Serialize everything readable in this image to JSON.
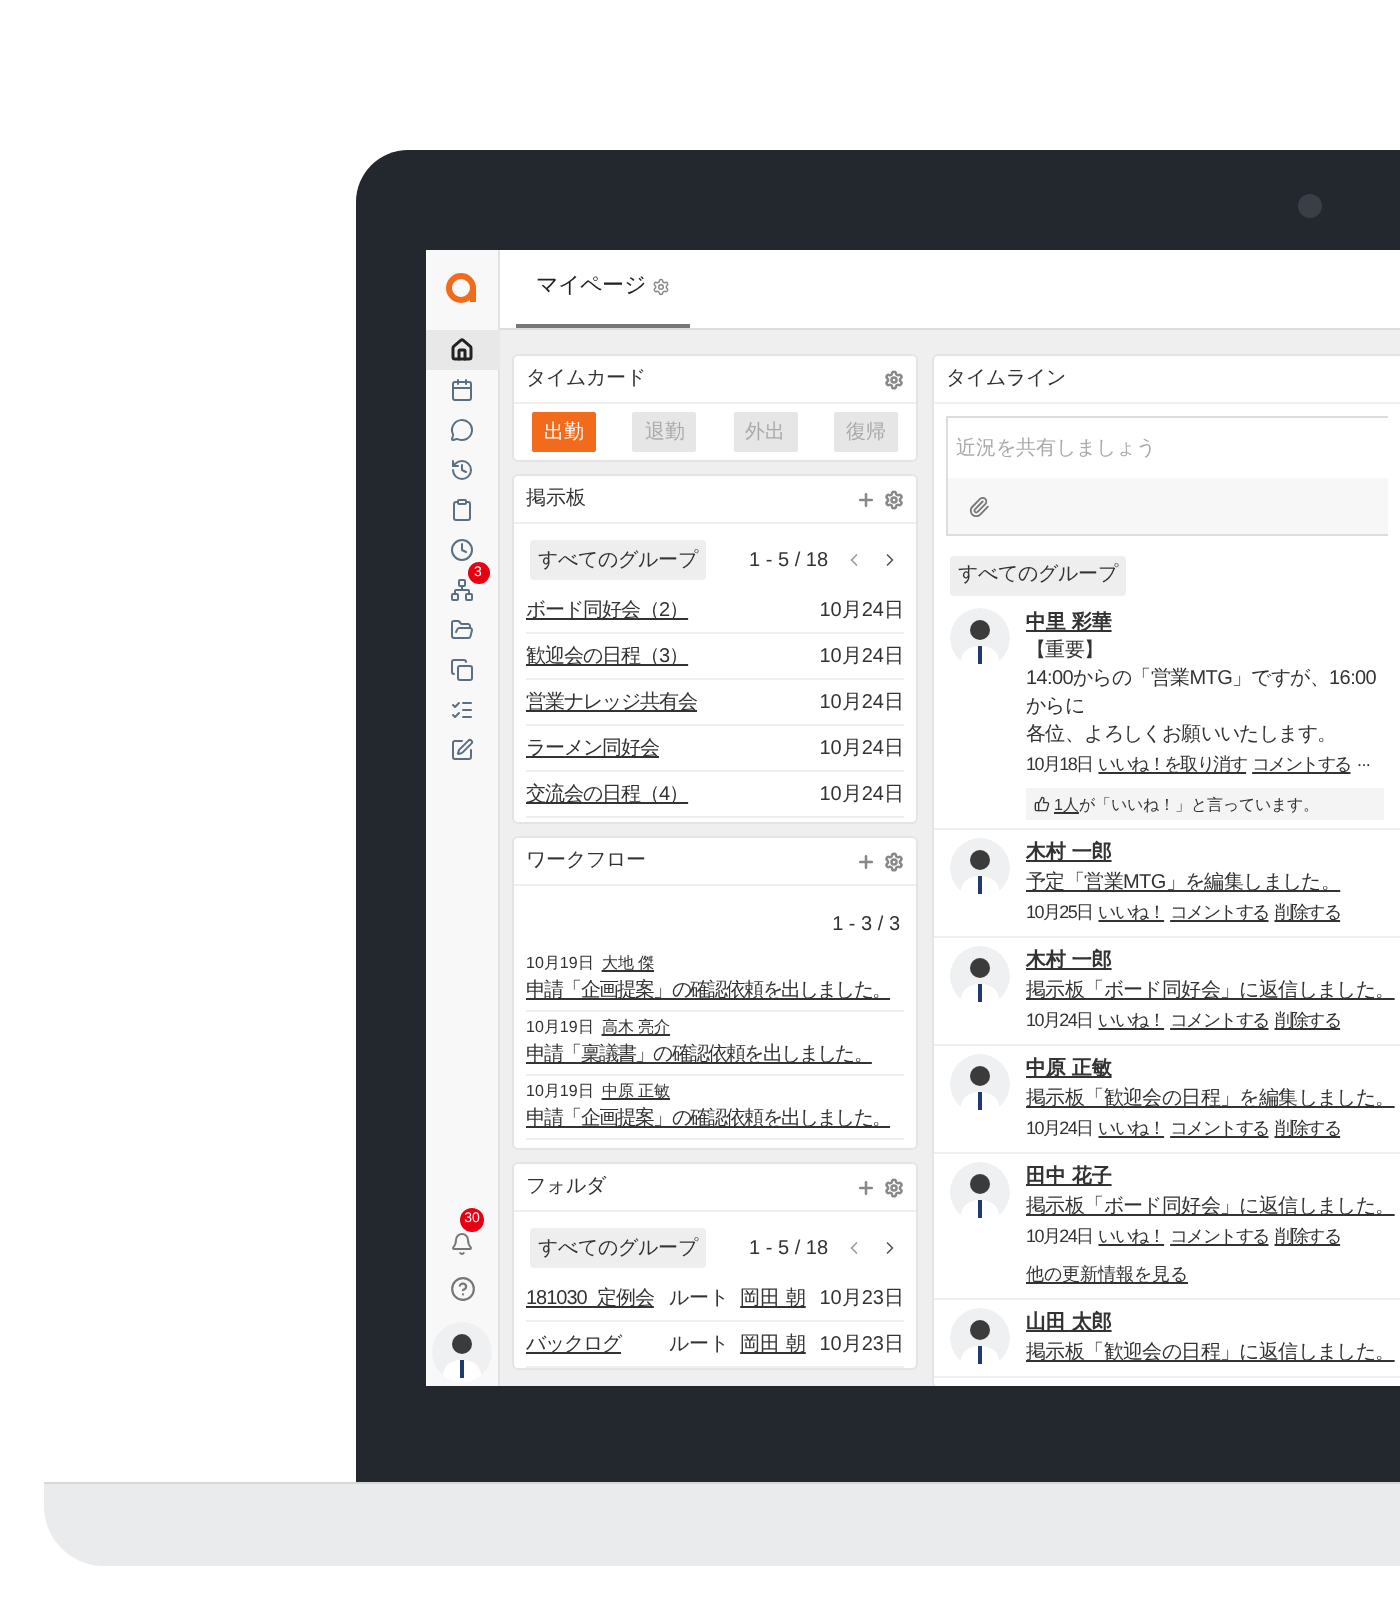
{
  "header": {
    "tab": "マイページ"
  },
  "sidebar": {
    "items": [
      {
        "selected": true
      },
      {
        "selected": false
      },
      {
        "selected": false
      },
      {
        "selected": false
      },
      {
        "selected": false
      },
      {
        "selected": false
      },
      {
        "selected": false,
        "badge": "3"
      },
      {
        "selected": false
      },
      {
        "selected": false
      },
      {
        "selected": false
      },
      {
        "selected": false
      }
    ],
    "bottom": [
      {
        "kind": "bell",
        "badge": "30"
      },
      {
        "kind": "help"
      }
    ]
  },
  "timecard": {
    "title": "タイムカード",
    "buttons": [
      {
        "label": "出勤",
        "selected": true
      },
      {
        "label": "退勤",
        "selected": false
      },
      {
        "label": "外出",
        "selected": false
      },
      {
        "label": "復帰",
        "selected": false
      }
    ]
  },
  "board": {
    "title": "掲示板",
    "group": "すべてのグループ",
    "pager": "1 - 5 / 18",
    "rows": [
      {
        "title": "ボード同好会（2）",
        "date": "10月24日"
      },
      {
        "title": "歓迎会の日程（3）",
        "date": "10月24日"
      },
      {
        "title": "営業ナレッジ共有会",
        "date": "10月24日"
      },
      {
        "title": "ラーメン同好会",
        "date": "10月24日"
      },
      {
        "title": "交流会の日程（4）",
        "date": "10月24日"
      }
    ]
  },
  "workflow": {
    "title": "ワークフロー",
    "pager": "1 - 3 / 3",
    "items": [
      {
        "date": "10月19日",
        "user": "大地 傑",
        "text": "申請「企画提案」の確認依頼を出しました。"
      },
      {
        "date": "10月19日",
        "user": "高木 亮介",
        "text": "申請「稟議書」の確認依頼を出しました。"
      },
      {
        "date": "10月19日",
        "user": "中原 正敏",
        "text": "申請「企画提案」の確認依頼を出しました。"
      }
    ]
  },
  "folder": {
    "title": "フォルダ",
    "group": "すべてのグループ",
    "pager": "1 - 5 / 18",
    "rows": [
      {
        "name": "181030_定例会",
        "location": "ルート",
        "owner": "岡田 朝",
        "date": "10月23日"
      },
      {
        "name": "バックログ",
        "location": "ルート",
        "owner": "岡田 朝",
        "date": "10月23日"
      }
    ]
  },
  "timeline": {
    "title": "タイムライン",
    "placeholder": "近況を共有しましょう",
    "group": "すべてのグループ",
    "posts": [
      {
        "name": "中里 彩華",
        "lines": [
          "【重要】",
          "14:00からの「営業MTG」ですが、16:00からに",
          "各位、よろしくお願いいたします。"
        ],
        "date": "10月18日",
        "actions": [
          "いいね！を取り消す",
          "コメントする"
        ],
        "more": "···",
        "likes_link": "1人",
        "likes_text": "が「いいね！」と言っています。"
      },
      {
        "name": "木村 一郎",
        "text": "予定「営業MTG」を編集しました。",
        "date": "10月25日",
        "actions": [
          "いいね！",
          "コメントする",
          "削除する"
        ]
      },
      {
        "name": "木村 一郎",
        "text": "掲示板「ボード同好会」に返信しました。",
        "date": "10月24日",
        "actions": [
          "いいね！",
          "コメントする",
          "削除する"
        ]
      },
      {
        "name": "中原 正敏",
        "text": "掲示板「歓迎会の日程」を編集しました。",
        "date": "10月24日",
        "actions": [
          "いいね！",
          "コメントする",
          "削除する"
        ]
      },
      {
        "name": "田中 花子",
        "text": "掲示板「ボード同好会」に返信しました。",
        "date": "10月24日",
        "actions": [
          "いいね！",
          "コメントする",
          "削除する"
        ],
        "see_more": "他の更新情報を見る"
      },
      {
        "name": "山田 太郎",
        "text": "掲示板「歓迎会の日程」に返信しました。"
      }
    ]
  }
}
